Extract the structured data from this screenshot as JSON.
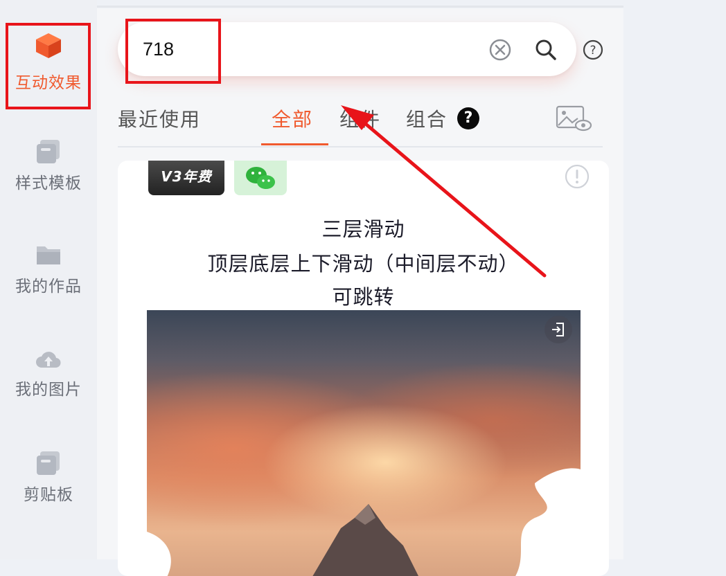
{
  "sidebar": {
    "items": [
      {
        "label": "互动效果",
        "icon": "cube-icon",
        "active": true
      },
      {
        "label": "样式模板",
        "icon": "template-icon",
        "active": false
      },
      {
        "label": "我的作品",
        "icon": "folder-icon",
        "active": false
      },
      {
        "label": "我的图片",
        "icon": "cloud-upload-icon",
        "active": false
      },
      {
        "label": "剪贴板",
        "icon": "clipboard-icon",
        "active": false
      }
    ]
  },
  "search": {
    "value": "718",
    "clear_icon": "clear-circle-icon",
    "search_icon": "magnifier-icon",
    "help_icon": "help-circle-icon"
  },
  "tabs": {
    "items": [
      {
        "label": "最近使用",
        "active": false
      },
      {
        "label": "全部",
        "active": true
      },
      {
        "label": "组件",
        "active": false
      },
      {
        "label": "组合",
        "active": false
      }
    ],
    "help_badge": "?",
    "preview_icon": "image-preview-icon"
  },
  "card": {
    "badge_v3": "V3年费",
    "badge_wechat_icon": "wechat-icon",
    "info_icon": "info-circle-icon",
    "title_lines": [
      "三层滑动",
      "顶层底层上下滑动（中间层不动）",
      "可跳转"
    ],
    "image_corner_icon": "enter-icon"
  },
  "colors": {
    "accent": "#f05a2e",
    "annotation": "#e8141a"
  }
}
